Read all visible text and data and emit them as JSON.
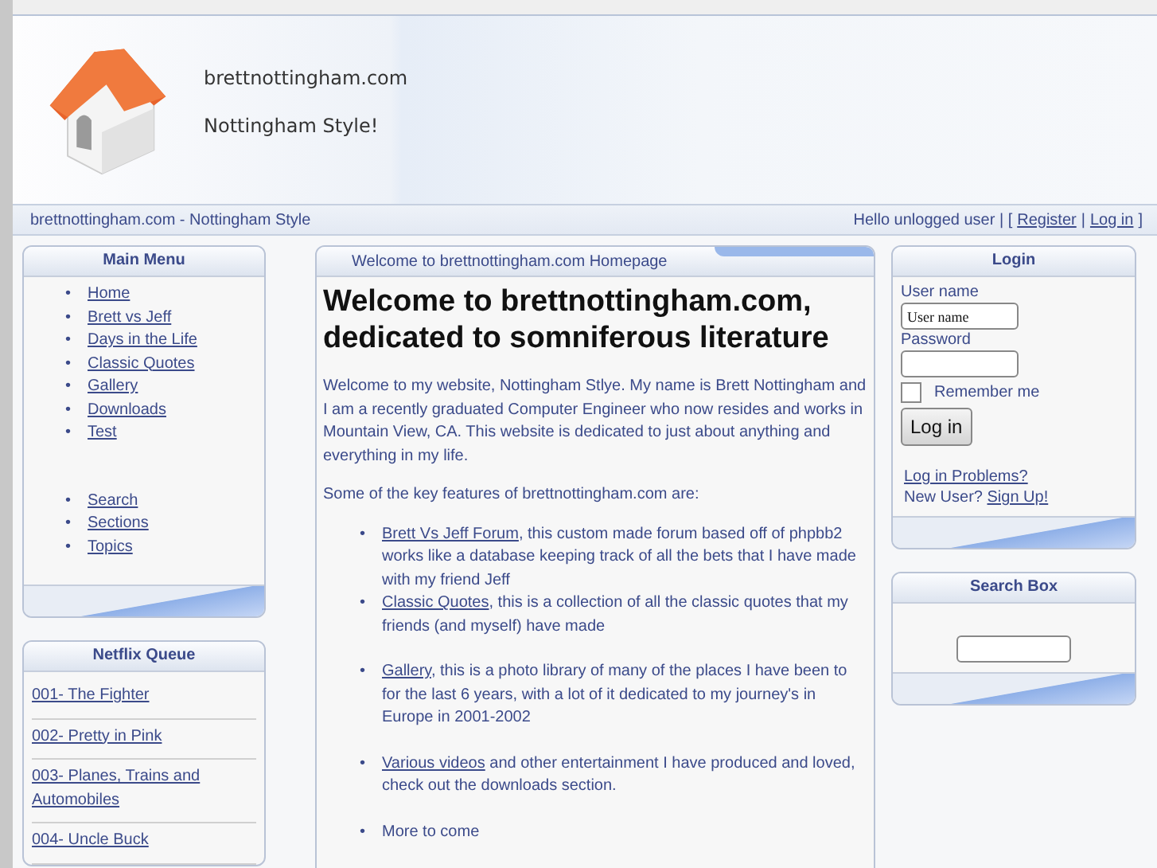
{
  "header": {
    "site_name": "brettnottingham.com",
    "tagline": "Nottingham Style!"
  },
  "nav_bar": {
    "title": "brettnottingham.com - Nottingham Style",
    "user_bar": [
      {
        "kind": "text",
        "text": "Hello unlogged user | ["
      },
      {
        "kind": "link",
        "text": "Register"
      },
      {
        "kind": "text",
        "text": "|"
      },
      {
        "kind": "link",
        "text": "Log in"
      },
      {
        "kind": "text",
        "text": "]"
      }
    ]
  },
  "main_menu": {
    "title": "Main Menu",
    "groups": [
      [
        {
          "bullet": "•",
          "label": "Home"
        },
        {
          "bullet": "•",
          "label": "Brett vs Jeff"
        },
        {
          "bullet": "•",
          "label": "Days in the Life"
        },
        {
          "bullet": "•",
          "label": "Classic Quotes"
        },
        {
          "bullet": "•",
          "label": "Gallery"
        },
        {
          "bullet": "•",
          "label": "Downloads"
        },
        {
          "bullet": "•",
          "label": "Test"
        }
      ],
      [
        {
          "bullet": "•",
          "label": "Search"
        },
        {
          "bullet": "•",
          "label": "Sections"
        },
        {
          "bullet": "•",
          "label": "Topics"
        }
      ]
    ]
  },
  "netflix_queue": {
    "title": "Netflix Queue",
    "items": [
      "001- The Fighter",
      "002- Pretty in Pink",
      "003- Planes, Trains and Automobiles",
      "004- Uncle Buck"
    ]
  },
  "content": {
    "tab": "Welcome to brettnottingham.com Homepage",
    "heading": "Welcome to brettnottingham.com, dedicated to somniferous literature",
    "intro": "Welcome to my website, Nottingham Stlye. My name is Brett Nottingham and I am a recently graduated Computer Engineer who now resides and works in Mountain View, CA. This website is dedicated to just about anything and everything in my life.",
    "features_intro": "Some of the key features of brettnottingham.com are:",
    "features": [
      {
        "bullet": "•",
        "link": "Brett Vs Jeff Forum",
        "text": ", this custom made forum based off of phpbb2 works like a database keeping track of all the bets that I have made with my friend Jeff"
      },
      {
        "bullet": "•",
        "link": "Classic Quotes",
        "text": ", this is a collection of all the classic quotes that my friends (and myself) have made"
      },
      {
        "bullet": "•",
        "link": "Gallery",
        "text": ", this is a photo library of many of the places I have been to for the last 6 years, with a lot of it dedicated to my journey's in Europe in 2001-2002"
      },
      {
        "bullet": "•",
        "link": "Various videos",
        "text": " and other entertainment I have produced and loved, check out the downloads section."
      },
      {
        "bullet": "•",
        "text": "More to come"
      }
    ]
  },
  "login": {
    "title": "Login",
    "username_label": "User name",
    "username_value": "User name",
    "password_label": "Password",
    "remember": {
      "label": "Remember me",
      "checked": false
    },
    "button": "Log in",
    "problems_link": "Log in Problems?",
    "new_user": "New User?",
    "signup_link": "Sign Up!"
  },
  "search_box": {
    "title": "Search Box"
  }
}
